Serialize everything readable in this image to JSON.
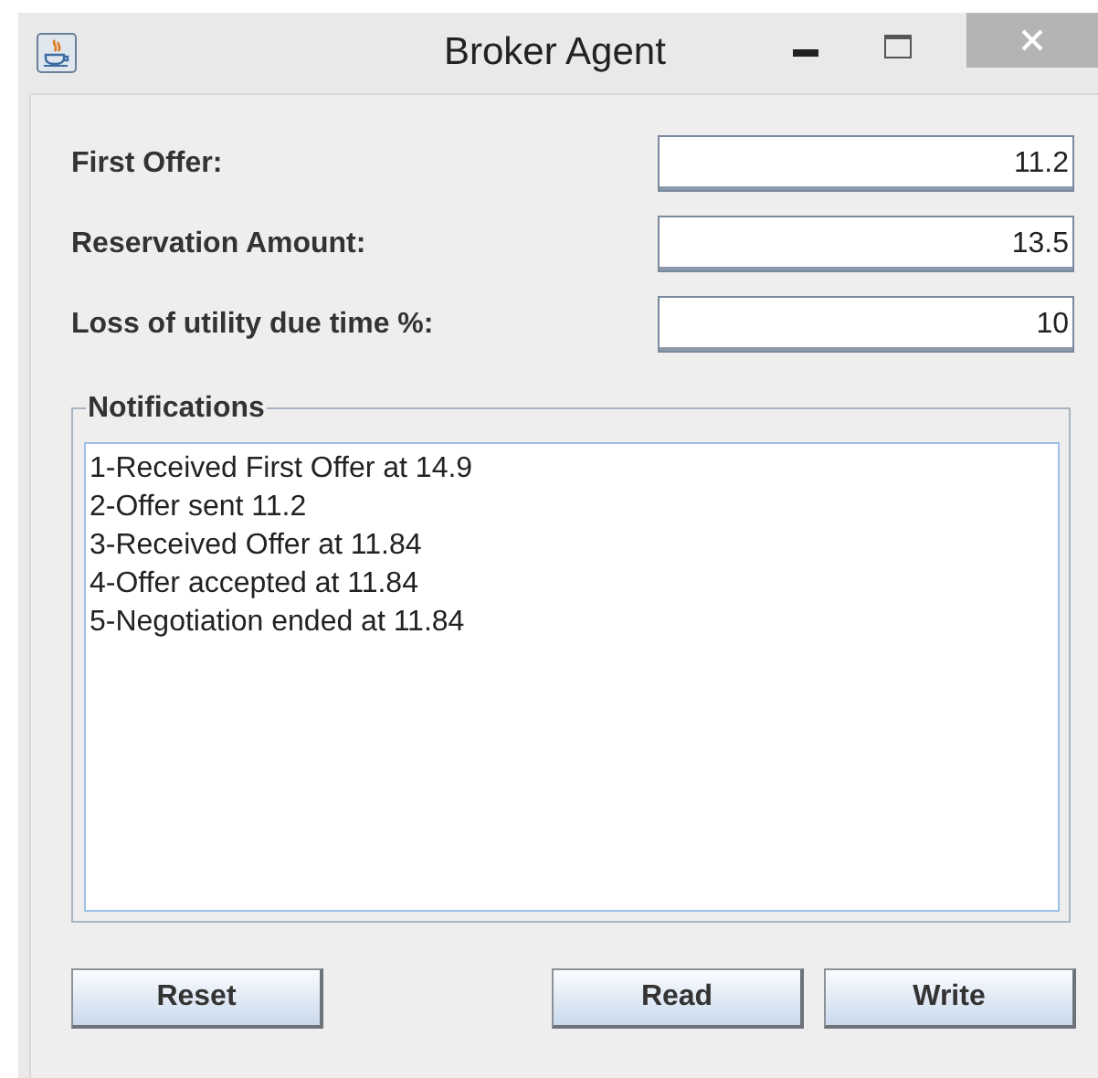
{
  "window": {
    "title": "Broker Agent"
  },
  "fields": [
    {
      "label": "First Offer:",
      "value": "11.2"
    },
    {
      "label": "Reservation Amount:",
      "value": "13.5"
    },
    {
      "label": "Loss of utility due time %:",
      "value": "10"
    }
  ],
  "notifications": {
    "title": "Notifications",
    "lines": [
      "1-Received First Offer at 14.9",
      "2-Offer sent 11.2",
      "3-Received Offer at 11.84",
      "4-Offer accepted at 11.84",
      "5-Negotiation ended at 11.84"
    ]
  },
  "buttons": [
    "Reset",
    "Read",
    "Write"
  ]
}
